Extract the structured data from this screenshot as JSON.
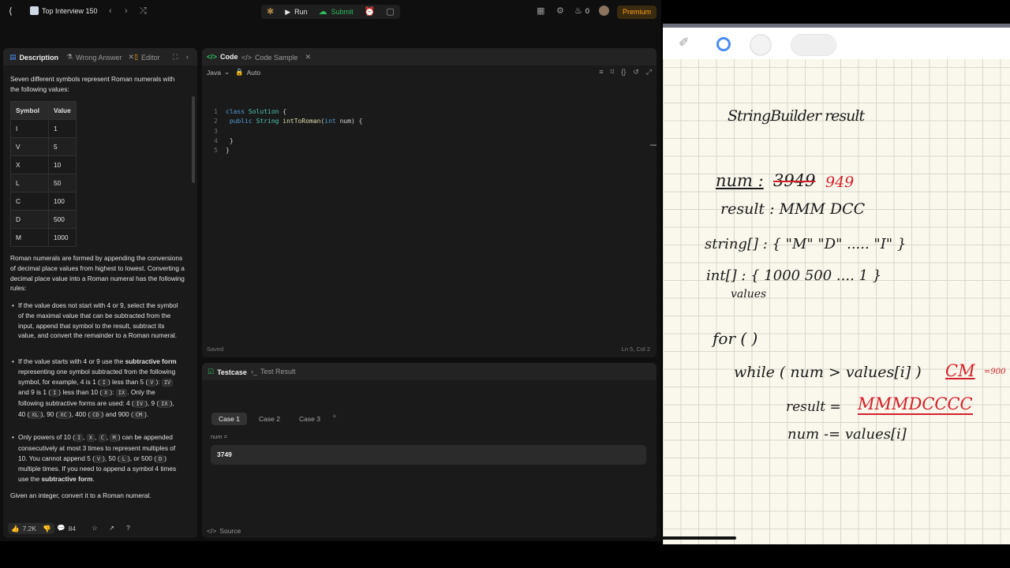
{
  "topbar": {
    "title": "Top Interview 150",
    "run": "Run",
    "submit": "Submit",
    "streak": "0",
    "premium": "Premium"
  },
  "description_panel": {
    "tabs": [
      "Description",
      "Wrong Answer",
      "Editor"
    ],
    "intro": "Seven different symbols represent Roman numerals with the following values:",
    "table_headers": [
      "Symbol",
      "Value"
    ],
    "table_rows": [
      [
        "I",
        "1"
      ],
      [
        "V",
        "5"
      ],
      [
        "X",
        "10"
      ],
      [
        "L",
        "50"
      ],
      [
        "C",
        "100"
      ],
      [
        "D",
        "500"
      ],
      [
        "M",
        "1000"
      ]
    ],
    "para1": "Roman numerals are formed by appending the conversions of decimal place values from highest to lowest. Converting a decimal place value into a Roman numeral has the following rules:",
    "bullet1": "If the value does not start with 4 or 9, select the symbol of the maximal value that can be subtracted from the input, append that symbol to the result, subtract its value, and convert the remainder to a Roman numeral.",
    "closing": "Given an integer, convert it to a Roman numeral.",
    "likes": "7.2K",
    "comments": "84"
  },
  "code_panel": {
    "tabs": [
      "Code",
      "Code Sample"
    ],
    "language": "Java",
    "mode": "Auto",
    "lines": [
      {
        "n": "1",
        "text": "class Solution {"
      },
      {
        "n": "2",
        "text": "    public String intToRoman(int num) {"
      },
      {
        "n": "3",
        "text": ""
      },
      {
        "n": "4",
        "text": "    }"
      },
      {
        "n": "5",
        "text": "}"
      }
    ],
    "status": "Saved",
    "cursor": "Ln 5, Col 2"
  },
  "test_panel": {
    "tabs": [
      "Testcase",
      "Test Result"
    ],
    "cases": [
      "Case 1",
      "Case 2",
      "Case 3"
    ],
    "var_label": "num =",
    "var_value": "3749",
    "source": "Source"
  },
  "notes": {
    "line1": "StringBuilder result",
    "num_label": "num :",
    "num_struck": "3949",
    "num_red": "949",
    "result_line": "result : MMM DCC",
    "string_line": "string[]  : { \"M\"    \"D\" .....        \"I\" }",
    "int_line": "int[]   :  { 1000     500   ....         1 }",
    "values_word": "values",
    "for_line": "for  (                          )",
    "while_line": "while ( num > values[i] )",
    "cm_note": "CM",
    "cm_small": "=900",
    "result_red_label": "result  =",
    "result_red": "MMMDCCCC",
    "num_minus": "num -= values[i]"
  }
}
